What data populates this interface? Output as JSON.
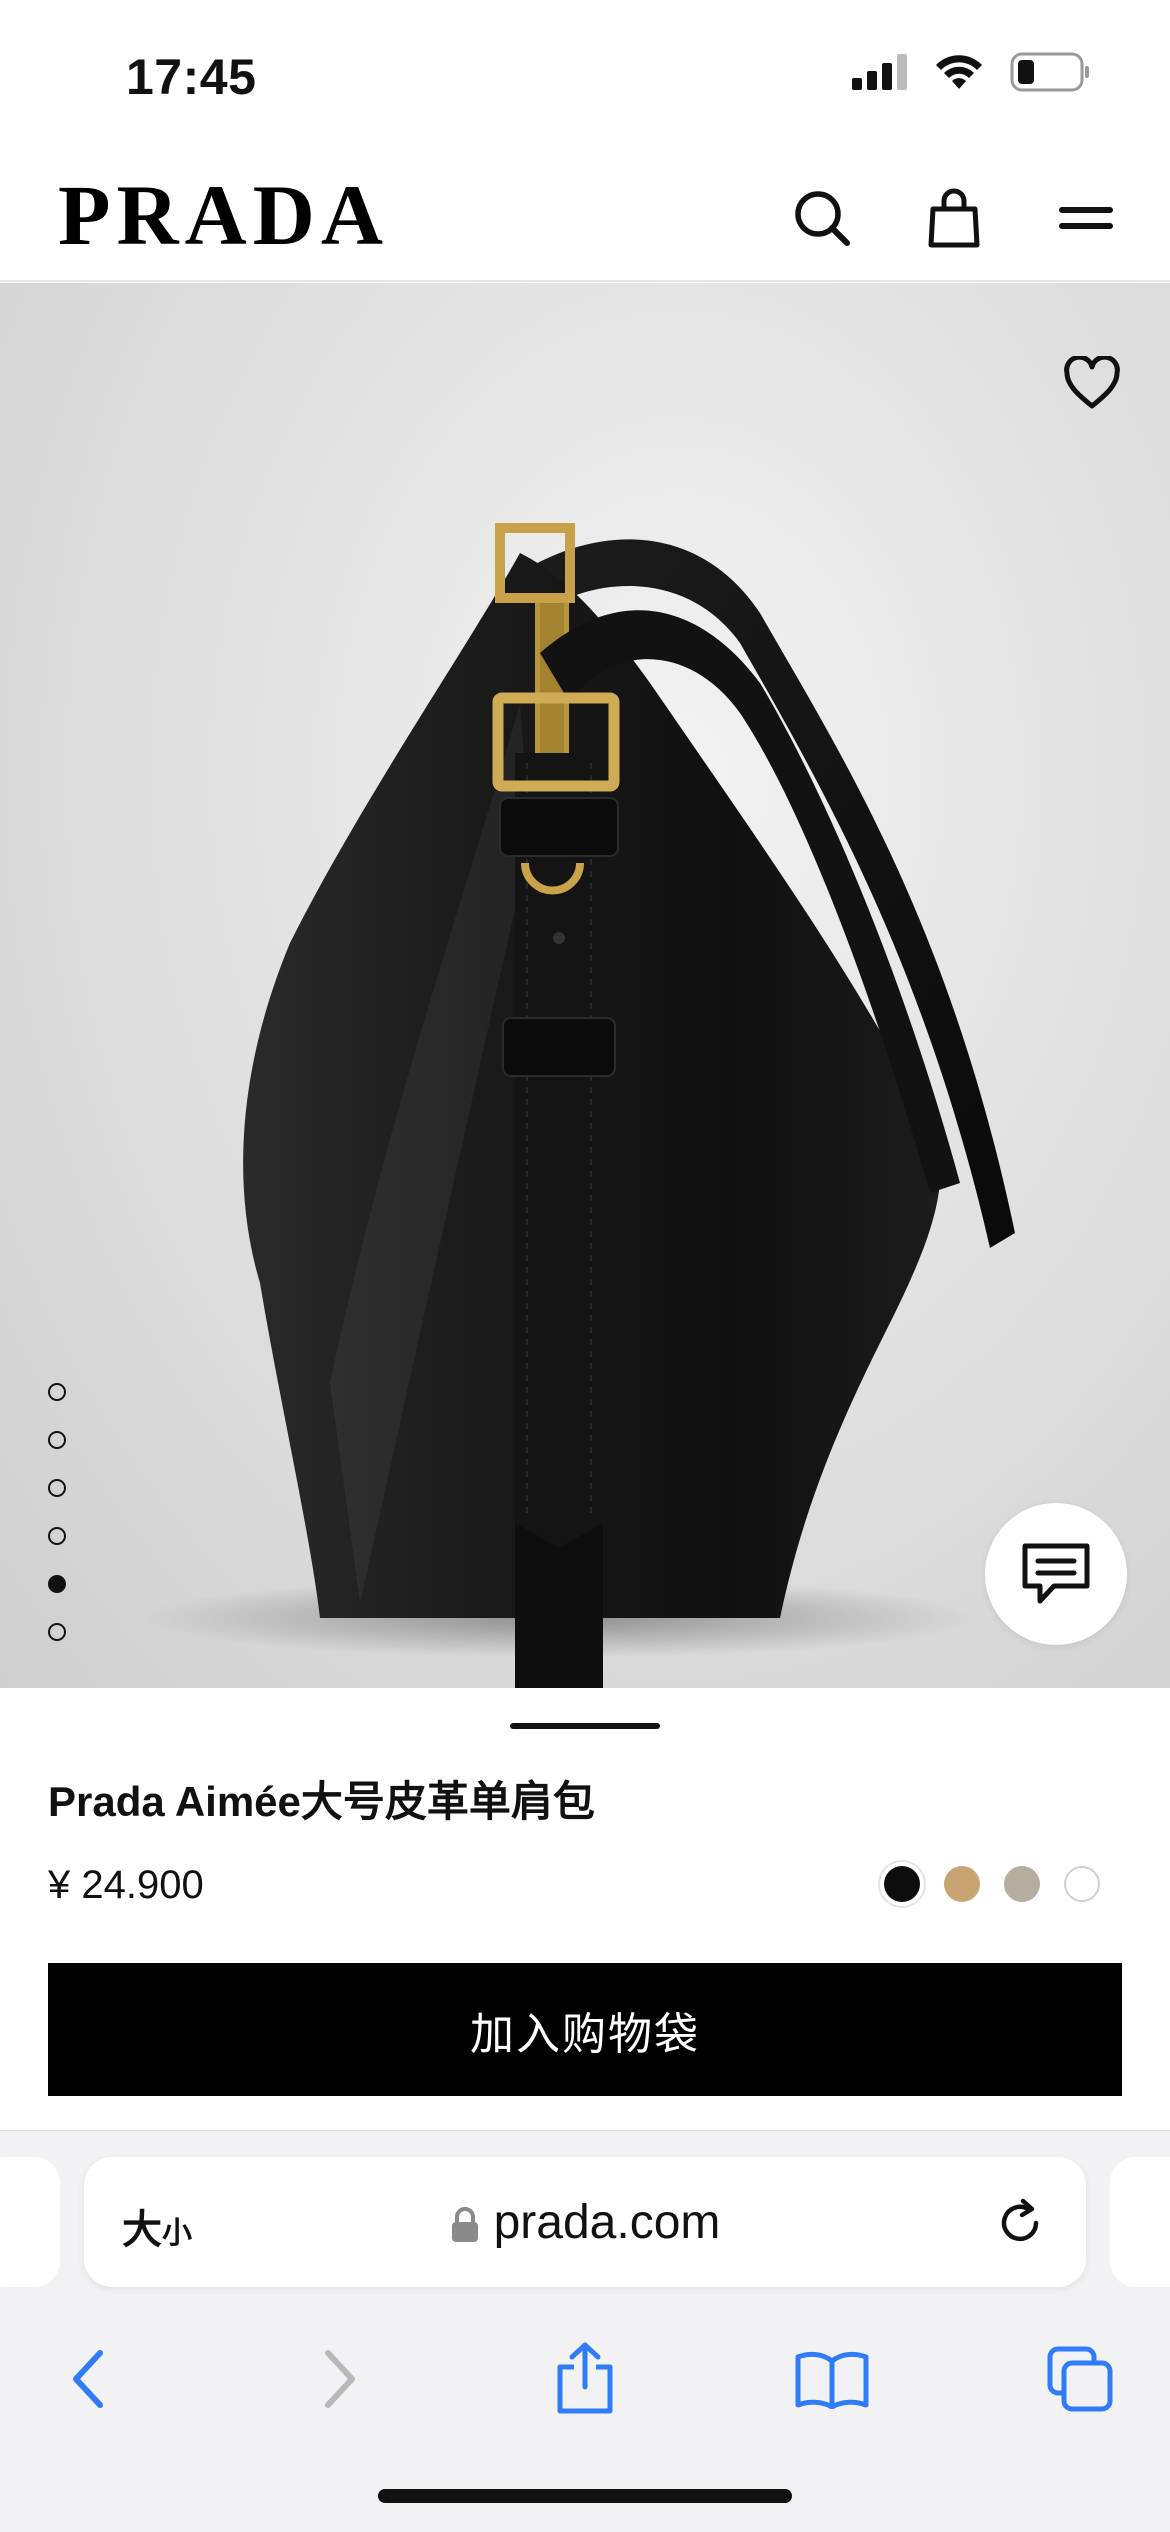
{
  "status_bar": {
    "time": "17:45"
  },
  "header": {
    "logo": "PRADA",
    "icons": [
      "search-icon",
      "shopping-bag-icon",
      "menu-icon"
    ]
  },
  "gallery": {
    "image_alt": "Prada Aimée大号皮革单肩包",
    "slide_count": 6,
    "active_slide": 5,
    "icons": [
      "heart-icon",
      "chat-icon"
    ]
  },
  "product": {
    "name": "Prada Aimée大号皮革单肩包",
    "price": "¥ 24.900",
    "colors": [
      "#0d0d0d",
      "#c9a473",
      "#b5ae9f",
      "#ffffff"
    ],
    "add_to_bag_label": "加入购物袋"
  },
  "browser": {
    "text_size_label": "大",
    "text_size_small": "小",
    "url": "prada.com",
    "icons": [
      "lock-icon",
      "reload-icon",
      "back-icon",
      "forward-icon",
      "share-icon",
      "bookmarks-icon",
      "tabs-icon"
    ]
  },
  "colors": {
    "accent": "#000000",
    "safari_blue": "#2f7cf6"
  }
}
